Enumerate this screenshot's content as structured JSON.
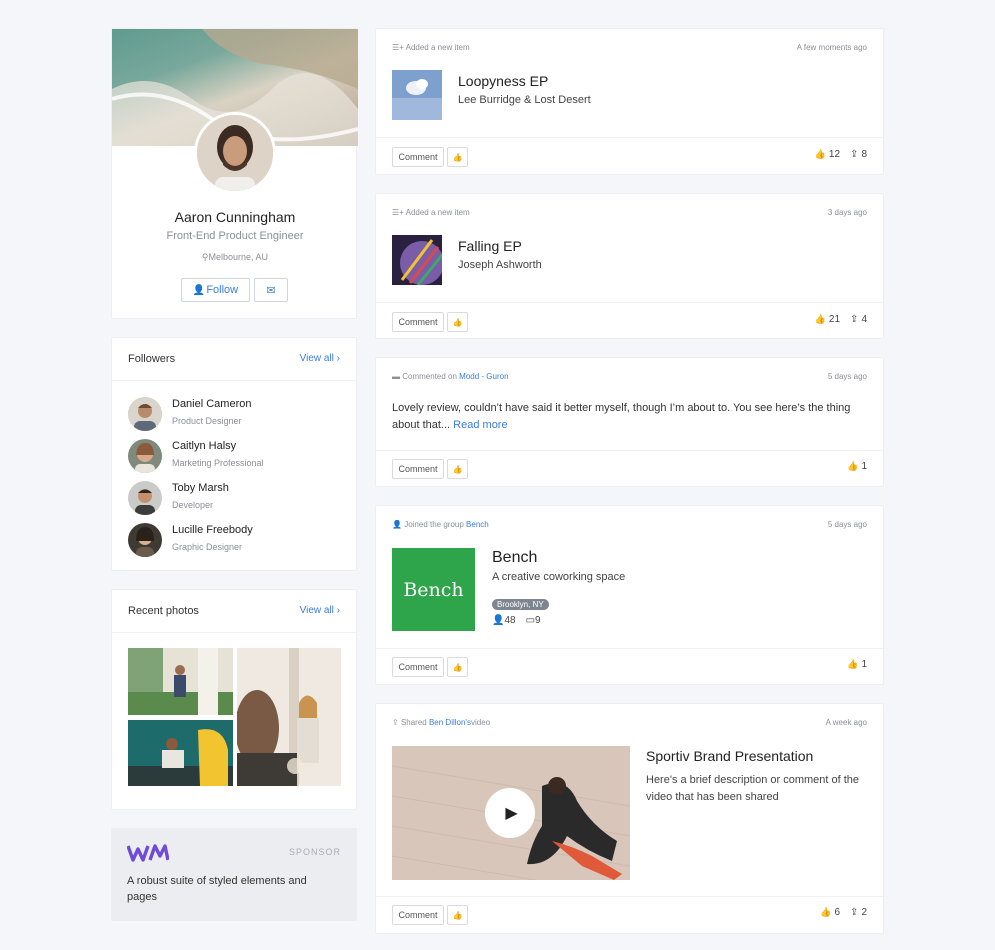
{
  "profile": {
    "name": "Aaron Cunningham",
    "title": "Front-End Product Engineer",
    "location": "Melbourne, AU",
    "follow_label": "Follow"
  },
  "followers": {
    "title": "Followers",
    "view_all": "View all ›",
    "items": [
      {
        "name": "Daniel Cameron",
        "role": "Product Designer"
      },
      {
        "name": "Caitlyn Halsy",
        "role": "Marketing Professional"
      },
      {
        "name": "Toby Marsh",
        "role": "Developer"
      },
      {
        "name": "Lucille Freebody",
        "role": "Graphic Designer"
      }
    ]
  },
  "photos": {
    "title": "Recent photos",
    "view_all": "View all ›"
  },
  "sponsor": {
    "label": "SPONSOR",
    "text": "A robust suite of styled elements and pages"
  },
  "feed": {
    "comment_label": "Comment",
    "posts": [
      {
        "action": "Added a new item",
        "time": "A few moments ago",
        "title": "Loopyness EP",
        "subtitle": "Lee Burridge & Lost Desert",
        "likes": "12",
        "shares": "8"
      },
      {
        "action": "Added a new item",
        "time": "3 days ago",
        "title": "Falling EP",
        "subtitle": "Joseph Ashworth",
        "likes": "21",
        "shares": "4"
      },
      {
        "action": "Commented on",
        "action_link": "Modd - Guron",
        "time": "5 days ago",
        "text": "Lovely review, couldn’t have said it better myself, though I’m about to. You see here’s the thing about that...",
        "read_more": "Read more",
        "likes": "1"
      },
      {
        "action": "Joined the group",
        "action_link": "Bench",
        "time": "5 days ago",
        "title": "Bench",
        "subtitle": "A creative coworking space",
        "tag": "Brooklyn, NY",
        "members": "48",
        "events": "9",
        "logo_text": "Bench",
        "likes": "1"
      },
      {
        "action": "Shared",
        "action_link": "Ben Dillon's",
        "action_suffix": "video",
        "time": "A week ago",
        "title": "Sportiv Brand Presentation",
        "text": "Here's a brief description or comment of the video that has been shared",
        "likes": "6",
        "shares": "2"
      }
    ]
  },
  "colors": {
    "accent": "#3b7ddd",
    "bench_green": "#2ea54a",
    "sponsor_logo": "#6f4bd8"
  }
}
